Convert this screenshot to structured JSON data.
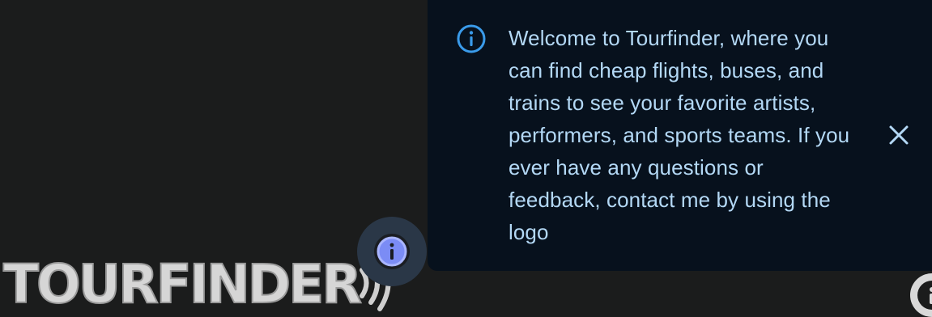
{
  "brand": {
    "logo_text": "TOURFINDER",
    "logo_color": "#d6d6d6"
  },
  "info_button": {
    "icon": "info-icon",
    "accent": "#8a9cff"
  },
  "popover": {
    "icon": "info-icon",
    "icon_color": "#3a9bea",
    "message": "Welcome to Tourfinder, where you can find cheap flights, buses, and trains to see your favorite artists, performers, and sports teams. If you ever have any questions or feedback, contact me by using the logo",
    "close_icon": "close-icon",
    "text_color": "#b3d8f5",
    "background": "#07111d"
  },
  "corner_info": {
    "icon": "info-icon"
  }
}
